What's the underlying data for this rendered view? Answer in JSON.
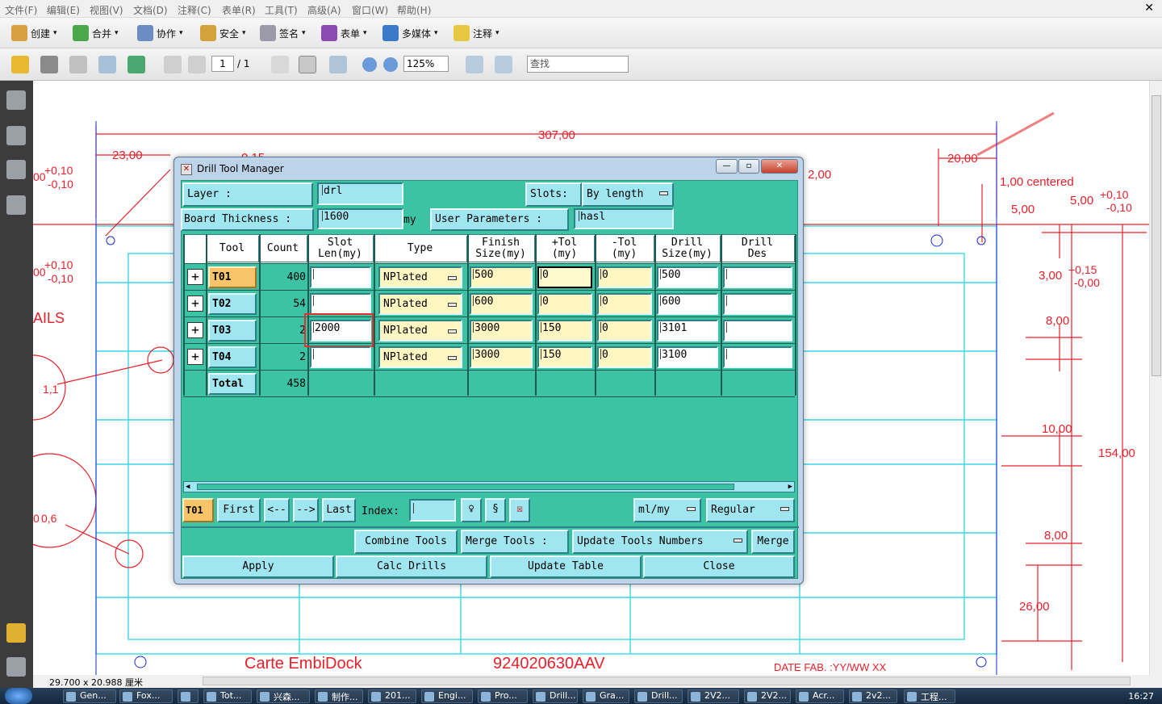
{
  "menubar": {
    "items": [
      "文件(F)",
      "编辑(E)",
      "视图(V)",
      "文档(D)",
      "注释(C)",
      "表单(R)",
      "工具(T)",
      "高级(A)",
      "窗口(W)",
      "帮助(H)"
    ],
    "close_glyph": "✕"
  },
  "toolbar1": {
    "buttons": [
      {
        "label": "创建",
        "icon": "create-icon"
      },
      {
        "label": "合并",
        "icon": "combine-icon"
      },
      {
        "label": "协作",
        "icon": "collaborate-icon"
      },
      {
        "label": "安全",
        "icon": "lock-icon"
      },
      {
        "label": "签名",
        "icon": "pen-icon"
      },
      {
        "label": "表单",
        "icon": "form-icon"
      },
      {
        "label": "多媒体",
        "icon": "multimedia-icon"
      },
      {
        "label": "注释",
        "icon": "comment-icon"
      }
    ]
  },
  "toolbar2": {
    "page_current": "1",
    "page_total": "/ 1",
    "zoom": "125%",
    "search_placeholder": "查找"
  },
  "dialog": {
    "title": "Drill Tool Manager",
    "layer_label": "Layer           :",
    "layer_value": "drl",
    "slots_label": "Slots:",
    "slots_value": "By length",
    "board_thickness_label": "Board Thickness :",
    "board_thickness_value": "1600",
    "board_thickness_unit": "my",
    "user_params_label": "User Parameters :",
    "user_params_value": "hasl",
    "columns": [
      "Tool",
      "Count",
      "Slot\nLen(my)",
      "Type",
      "Finish\nSize(my)",
      "+Tol\n(my)",
      "-Tol\n(my)",
      "Drill\nSize(my)",
      "Drill\nDes"
    ],
    "rows": [
      {
        "tool": "T01",
        "count": "400",
        "slot_len": "",
        "type": "NPlated",
        "finish": "500",
        "ptol": "0",
        "mtol": "0",
        "drill": "500",
        "des": ""
      },
      {
        "tool": "T02",
        "count": "54",
        "slot_len": "",
        "type": "NPlated",
        "finish": "600",
        "ptol": "0",
        "mtol": "0",
        "drill": "600",
        "des": ""
      },
      {
        "tool": "T03",
        "count": "2",
        "slot_len": "2000",
        "type": "NPlated",
        "finish": "3000",
        "ptol": "150",
        "mtol": "0",
        "drill": "3101",
        "des": ""
      },
      {
        "tool": "T04",
        "count": "2",
        "slot_len": "",
        "type": "NPlated",
        "finish": "3000",
        "ptol": "150",
        "mtol": "0",
        "drill": "3100",
        "des": ""
      }
    ],
    "total_label": "Total",
    "total_count": "458",
    "nav": {
      "current": "T01",
      "first": "First",
      "prev": "<--",
      "next": "-->",
      "last": "Last",
      "index_label": "Index:",
      "units": "ml/my",
      "mode": "Regular"
    },
    "combine_tools": "Combine Tools",
    "merge_tools_label": "Merge Tools :",
    "update_numbers": "Update Tools Numbers",
    "merge": "Merge",
    "apply": "Apply",
    "calc_drills": "Calc Drills",
    "update_table": "Update Table",
    "close": "Close"
  },
  "drawing": {
    "dims": {
      "d307": "307,00",
      "d23": "23,00",
      "d20": "20,00",
      "d2": "2,00",
      "d015": "0,15",
      "centered": "1,00 centered",
      "d5": "5,00",
      "d5tol": "5,00",
      "tolp010": "+0,10",
      "tolm010": "-0,10",
      "d3": "3,00",
      "tolp015": "+0,15",
      "tolm000": "-0,00",
      "d8a": "8,00",
      "d10": "10,00",
      "d154": "154,00",
      "d8b": "8,00",
      "d26": "26,00",
      "d11": "1,1",
      "d06": "0,6",
      "ails": "AILS",
      "tol00": "00",
      "tol06": "0"
    },
    "bottom_left": "Carte EmbiDock",
    "bottom_mid": "924020630AAV",
    "bottom_right": "DATE FAB. :YY/WW XX",
    "red": "#e8202a",
    "cyan": "#38d8e8",
    "blue": "#1a2ad8"
  },
  "statusbar": {
    "dims": "29.700 x 20.988 厘米"
  },
  "taskbar": {
    "tasks": [
      "Gen...",
      "Fox...",
      "",
      "Tot...",
      "兴森...",
      "制作...",
      "201...",
      "Engi...",
      "Pro...",
      "Drill...",
      "Gra...",
      "Drill...",
      "2V2...",
      "2V2...",
      "Acr...",
      "2v2...",
      "工程..."
    ],
    "clock": "16:27"
  }
}
